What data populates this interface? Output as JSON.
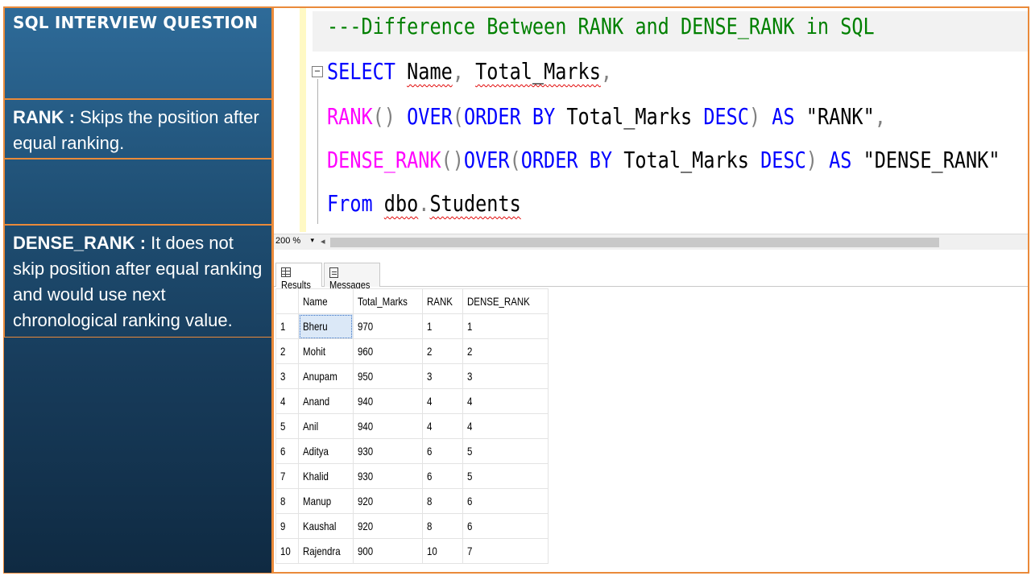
{
  "left_panel": {
    "title": "SQL INTERVIEW QUESTION",
    "rank_term": "RANK :",
    "rank_text": " Skips the position after equal ranking.",
    "dense_term": "DENSE_RANK :",
    "dense_text": " It does not skip position after equal ranking  and would use next chronological ranking value."
  },
  "editor": {
    "comment": "---Difference Between RANK and DENSE_RANK in SQL",
    "line2": {
      "select": "SELECT",
      "name": "Name",
      "comma1": ",",
      "marks": "Total_Marks",
      "comma2": ","
    },
    "line3": {
      "fn": "RANK",
      "paren_open": "()",
      "over": "OVER",
      "p1": "(",
      "order": "ORDER",
      "by": "BY",
      "col": "Total_Marks",
      "desc": "DESC",
      "p2": ")",
      "as": "AS",
      "alias": "\"RANK\"",
      "comma": ","
    },
    "line4": {
      "fn": "DENSE_RANK",
      "paren_open": "()",
      "over": "OVER",
      "p1": "(",
      "order": "ORDER",
      "by": "BY",
      "col": "Total_Marks",
      "desc": "DESC",
      "p2": ")",
      "as": "AS",
      "alias": "\"DENSE_RANK\""
    },
    "line5": {
      "from": "From",
      "schema": "dbo",
      "dot": ".",
      "table": "Students"
    },
    "collapse_glyph": "−"
  },
  "statusbar": {
    "zoom": "200 %",
    "zoom_arrow": "▾",
    "scroll_left": "◂"
  },
  "tabs": [
    {
      "label": "Results"
    },
    {
      "label": "Messages"
    }
  ],
  "results": {
    "columns": [
      "Name",
      "Total_Marks",
      "RANK",
      "DENSE_RANK"
    ],
    "rows": [
      [
        "1",
        "Bheru",
        "970",
        "1",
        "1"
      ],
      [
        "2",
        "Mohit",
        "960",
        "2",
        "2"
      ],
      [
        "3",
        "Anupam",
        "950",
        "3",
        "3"
      ],
      [
        "4",
        "Anand",
        "940",
        "4",
        "4"
      ],
      [
        "5",
        "Anil",
        "940",
        "4",
        "4"
      ],
      [
        "6",
        "Aditya",
        "930",
        "6",
        "5"
      ],
      [
        "7",
        "Khalid",
        "930",
        "6",
        "5"
      ],
      [
        "8",
        "Manup",
        "920",
        "8",
        "6"
      ],
      [
        "9",
        "Kaushal",
        "920",
        "8",
        "6"
      ],
      [
        "10",
        "Rajendra",
        "900",
        "10",
        "7"
      ]
    ]
  },
  "colors": {
    "panel_border": "#ea8a3a",
    "comment": "#008000",
    "keyword": "#0000ff",
    "function": "#ff00ff",
    "operator": "#808080",
    "panel_top": "#2e6b99",
    "panel_bottom": "#0f2a42"
  }
}
